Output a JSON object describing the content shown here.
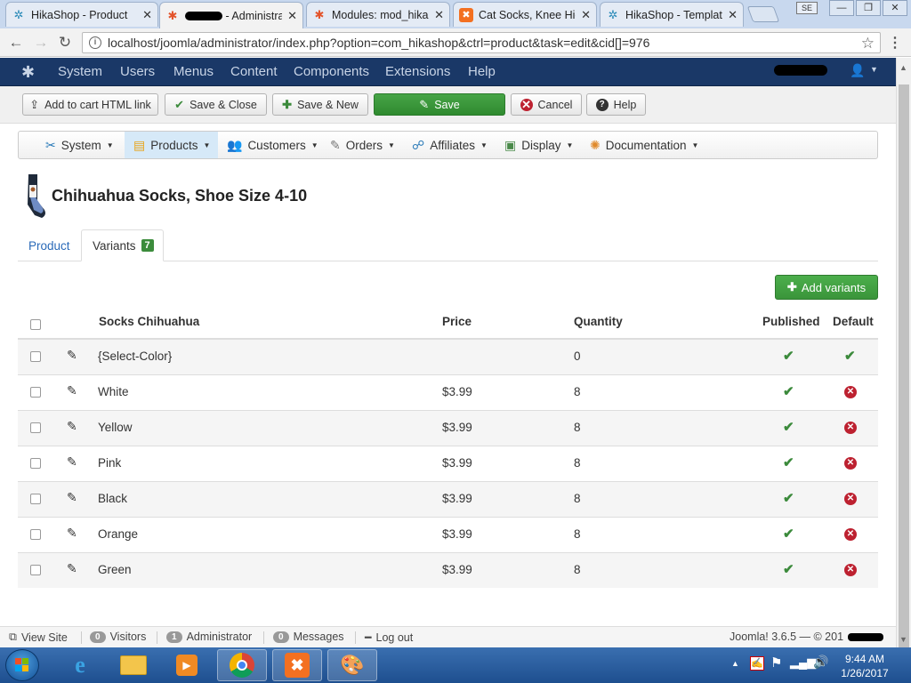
{
  "browser": {
    "tabs": [
      {
        "title": "HikaShop - Product",
        "icon": "hikashop-icon"
      },
      {
        "title": " - Administra",
        "icon": "joomla-icon"
      },
      {
        "title": "Modules: mod_hika",
        "icon": "joomla-icon"
      },
      {
        "title": "Cat Socks, Knee Hig",
        "icon": "xampp-icon"
      },
      {
        "title": "HikaShop - Templat",
        "icon": "hikashop-icon"
      }
    ],
    "se_label": "SE",
    "url": "localhost/joomla/administrator/index.php?option=com_hikashop&ctrl=product&task=edit&cid[]=976"
  },
  "joomla_nav": {
    "items": [
      "System",
      "Users",
      "Menus",
      "Content",
      "Components",
      "Extensions",
      "Help"
    ]
  },
  "toolbar": {
    "add_to_cart": "Add to cart HTML link",
    "save_close": "Save & Close",
    "save_new": "Save & New",
    "save": "Save",
    "cancel": "Cancel",
    "help": "Help"
  },
  "hika_menu": [
    {
      "label": "System",
      "icon": "tools-icon"
    },
    {
      "label": "Products",
      "icon": "box-icon"
    },
    {
      "label": "Customers",
      "icon": "users-icon"
    },
    {
      "label": "Orders",
      "icon": "orders-icon"
    },
    {
      "label": "Affiliates",
      "icon": "affiliates-icon"
    },
    {
      "label": "Display",
      "icon": "display-icon"
    },
    {
      "label": "Documentation",
      "icon": "documentation-icon"
    }
  ],
  "product": {
    "title": "Chihuahua Socks, Shoe Size 4-10"
  },
  "tabs": {
    "product": "Product",
    "variants": "Variants",
    "variants_count": "7"
  },
  "add_variants": "Add variants",
  "table": {
    "headers": {
      "name": "Socks Chihuahua",
      "price": "Price",
      "quantity": "Quantity",
      "published": "Published",
      "default": "Default"
    },
    "rows": [
      {
        "name": "{Select-Color}",
        "price": "",
        "quantity": "0",
        "published": true,
        "default": true
      },
      {
        "name": "White",
        "price": "$3.99",
        "quantity": "8",
        "published": true,
        "default": false
      },
      {
        "name": "Yellow",
        "price": "$3.99",
        "quantity": "8",
        "published": true,
        "default": false
      },
      {
        "name": "Pink",
        "price": "$3.99",
        "quantity": "8",
        "published": true,
        "default": false
      },
      {
        "name": "Black",
        "price": "$3.99",
        "quantity": "8",
        "published": true,
        "default": false
      },
      {
        "name": "Orange",
        "price": "$3.99",
        "quantity": "8",
        "published": true,
        "default": false
      },
      {
        "name": "Green",
        "price": "$3.99",
        "quantity": "8",
        "published": true,
        "default": false
      }
    ]
  },
  "status": {
    "view_site": "View Site",
    "visitors_count": "0",
    "visitors": "Visitors",
    "admin_count": "1",
    "admin": "Administrator",
    "messages_count": "0",
    "messages": "Messages",
    "logout": "Log out",
    "version": "Joomla! 3.6.5 — © 201"
  },
  "taskbar": {
    "time": "9:44 AM",
    "date": "1/26/2017"
  }
}
